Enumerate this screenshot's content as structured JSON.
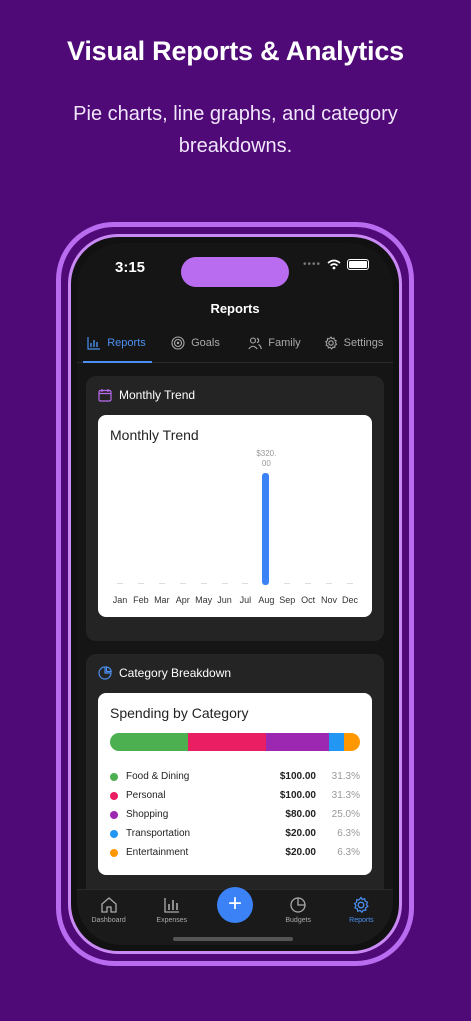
{
  "promo": {
    "headline": "Visual Reports & Analytics",
    "subline": "Pie charts, line graphs, and category breakdowns."
  },
  "status": {
    "time": "3:15"
  },
  "nav": {
    "title": "Reports"
  },
  "tabs": [
    {
      "label": "Reports",
      "icon": "bar-chart-icon",
      "active": true
    },
    {
      "label": "Goals",
      "icon": "target-icon",
      "active": false
    },
    {
      "label": "Family",
      "icon": "people-icon",
      "active": false
    },
    {
      "label": "Settings",
      "icon": "gear-icon",
      "active": false
    }
  ],
  "monthly": {
    "section_title": "Monthly Trend",
    "card_title": "Monthly Trend"
  },
  "category": {
    "section_title": "Category Breakdown",
    "card_title": "Spending by Category"
  },
  "chart_data": [
    {
      "type": "bar",
      "title": "Monthly Trend",
      "categories": [
        "Jan",
        "Feb",
        "Mar",
        "Apr",
        "May",
        "Jun",
        "Jul",
        "Aug",
        "Sep",
        "Oct",
        "Nov",
        "Dec"
      ],
      "values": [
        0,
        0,
        0,
        0,
        0,
        0,
        0,
        320,
        0,
        0,
        0,
        0
      ],
      "data_labels": [
        "",
        "",
        "",
        "",
        "",
        "",
        "",
        "$320.00",
        "",
        "",
        "",
        ""
      ],
      "color": "#3b82f6",
      "grid": false
    },
    {
      "type": "bar",
      "title": "Spending by Category",
      "stacked": true,
      "categories": [
        "Food & Dining",
        "Personal",
        "Shopping",
        "Transportation",
        "Entertainment"
      ],
      "values": [
        100,
        100,
        80,
        20,
        20
      ],
      "amounts": [
        "$100.00",
        "$100.00",
        "$80.00",
        "$20.00",
        "$20.00"
      ],
      "percents": [
        "31.3%",
        "31.3%",
        "25.0%",
        "6.3%",
        "6.3%"
      ],
      "colors": [
        "#4caf50",
        "#e91e63",
        "#9c27b0",
        "#2196f3",
        "#ff9800"
      ]
    }
  ],
  "bottom_nav": [
    {
      "label": "Dashboard",
      "icon": "home-icon",
      "active": false
    },
    {
      "label": "Expenses",
      "icon": "bar-chart-icon",
      "active": false
    },
    {
      "label": "Budgets",
      "icon": "pie-chart-icon",
      "active": false
    },
    {
      "label": "Reports",
      "icon": "gear-icon",
      "active": true
    }
  ],
  "fab": {
    "label": "+"
  },
  "colors": {
    "background": "#4f0a78",
    "accent": "#4b90f0",
    "frame": "#b96cf0"
  }
}
